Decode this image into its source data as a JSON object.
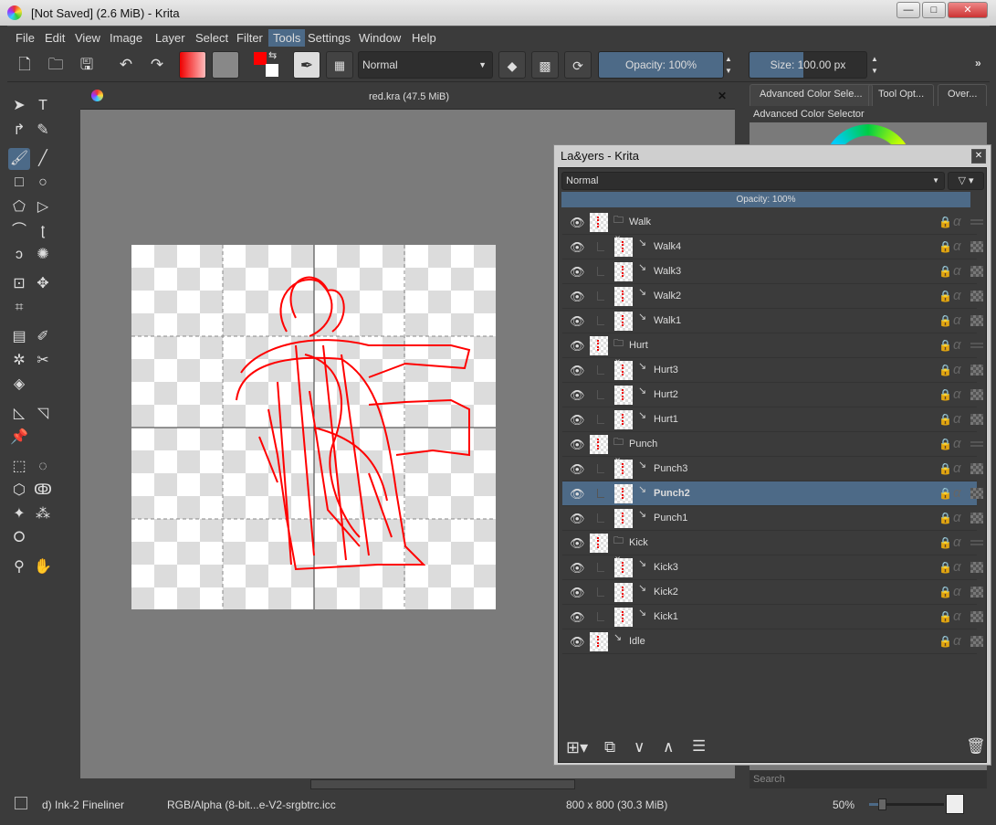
{
  "window": {
    "title": "[Not Saved]  (2.6 MiB)  - Krita",
    "min": "—",
    "max": "□",
    "close": "✕"
  },
  "menu": [
    "File",
    "Edit",
    "View",
    "Image",
    "Layer",
    "Select",
    "Filter",
    "Tools",
    "Settings",
    "Window",
    "Help"
  ],
  "menu_active": "Tools",
  "toolbar": {
    "blend_mode": "Normal",
    "opacity": "Opacity:  100%",
    "size": "Size:  100.00 px",
    "overflow": "»",
    "accent": "#4d6a87",
    "fg_color": "#ff0000",
    "bg_color": "#ffffff"
  },
  "document": {
    "tab_title": "red.kra (47.5 MiB)",
    "close": "✕"
  },
  "dock": {
    "tabs": [
      "Advanced Color Sele...",
      "Tool Opt...",
      "Over..."
    ],
    "panel_title": "Advanced Color Selector",
    "search_placeholder": "Search"
  },
  "layers": {
    "title": "La&yers - Krita",
    "blend_mode": "Normal",
    "opacity": "Opacity:  100%",
    "items": [
      {
        "name": "Walk",
        "type": "group",
        "child": false,
        "locked": false,
        "selected": false
      },
      {
        "name": "Walk4",
        "type": "paint",
        "child": true,
        "locked": false,
        "selected": false
      },
      {
        "name": "Walk3",
        "type": "paint",
        "child": true,
        "locked": false,
        "selected": false
      },
      {
        "name": "Walk2",
        "type": "paint",
        "child": true,
        "locked": true,
        "selected": false
      },
      {
        "name": "Walk1",
        "type": "paint",
        "child": true,
        "locked": true,
        "selected": false
      },
      {
        "name": "Hurt",
        "type": "group",
        "child": false,
        "locked": false,
        "selected": false
      },
      {
        "name": "Hurt3",
        "type": "paint",
        "child": true,
        "locked": false,
        "selected": false
      },
      {
        "name": "Hurt2",
        "type": "paint",
        "child": true,
        "locked": false,
        "selected": false
      },
      {
        "name": "Hurt1",
        "type": "paint",
        "child": true,
        "locked": true,
        "selected": false
      },
      {
        "name": "Punch",
        "type": "group",
        "child": false,
        "locked": false,
        "selected": false
      },
      {
        "name": "Punch3",
        "type": "paint",
        "child": true,
        "locked": false,
        "selected": false
      },
      {
        "name": "Punch2",
        "type": "paint",
        "child": true,
        "locked": false,
        "selected": true
      },
      {
        "name": "Punch1",
        "type": "paint",
        "child": true,
        "locked": true,
        "selected": false
      },
      {
        "name": "Kick",
        "type": "group",
        "child": false,
        "locked": false,
        "selected": false
      },
      {
        "name": "Kick3",
        "type": "paint",
        "child": true,
        "locked": false,
        "selected": false
      },
      {
        "name": "Kick2",
        "type": "paint",
        "child": true,
        "locked": false,
        "selected": false
      },
      {
        "name": "Kick1",
        "type": "paint",
        "child": true,
        "locked": true,
        "selected": false
      },
      {
        "name": "Idle",
        "type": "paint",
        "child": false,
        "locked": true,
        "selected": false
      }
    ]
  },
  "status": {
    "brush": "d) Ink-2 Fineliner",
    "colorspace": "RGB/Alpha (8-bit...e-V2-srgbtrc.icc",
    "size": "800 x 800 (30.3 MiB)",
    "zoom": "50%",
    "zoom_fraction": 0.15
  }
}
